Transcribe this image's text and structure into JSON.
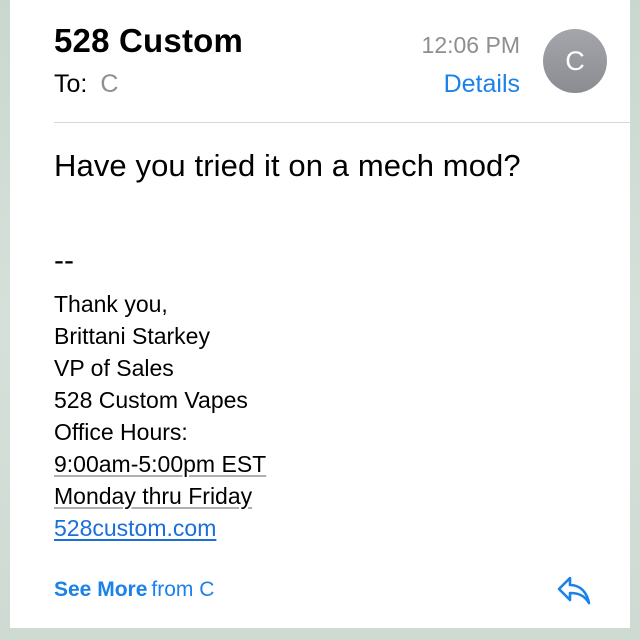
{
  "header": {
    "sender": "528 Custom",
    "time": "12:06 PM",
    "avatar_initial": "C",
    "to_label": "To:",
    "to_value": "C",
    "details_label": "Details"
  },
  "message": {
    "subject_line": "Have you tried it on a mech mod?",
    "signature_separator": "--",
    "signature_lines": [
      "Thank you,",
      "Brittani Starkey",
      "VP of Sales",
      "528 Custom Vapes",
      "Office Hours:",
      "9:00am-5:00pm EST",
      "Monday thru Friday"
    ],
    "signature_link": "528custom.com"
  },
  "footer": {
    "see_more_label": "See More",
    "see_more_from": "from C",
    "reply_icon": "reply-arrow-icon"
  },
  "colors": {
    "accent": "#1a82e8",
    "secondary_text": "#8e8e93",
    "avatar": "#9a9ca1"
  }
}
